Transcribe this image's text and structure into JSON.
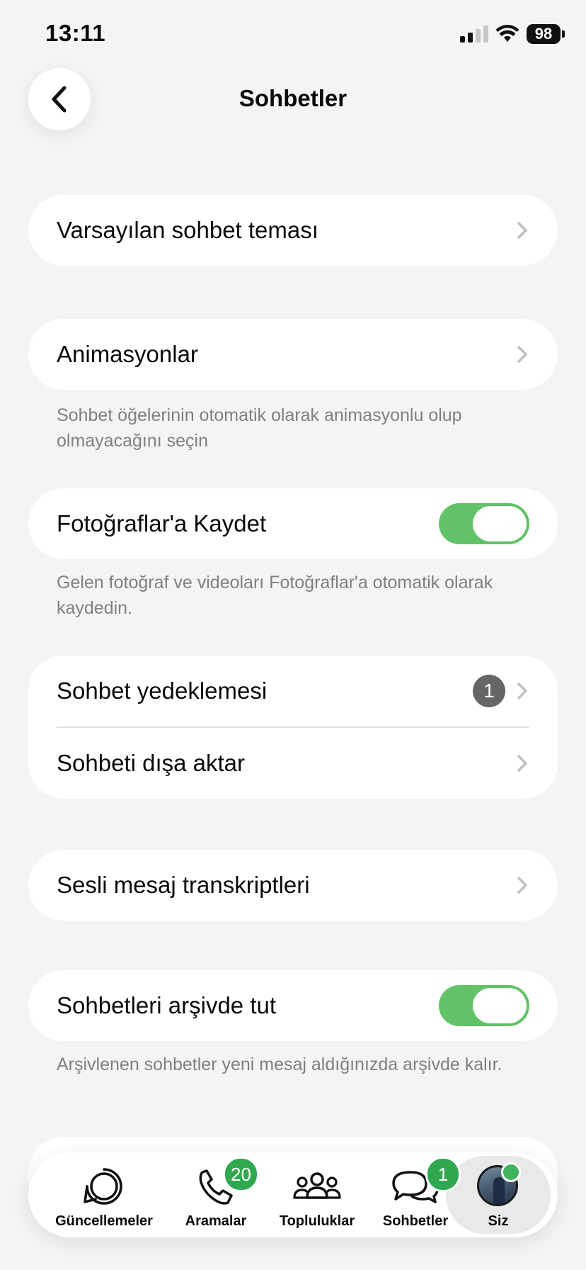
{
  "status_bar": {
    "time": "13:11",
    "battery": "98"
  },
  "header": {
    "title": "Sohbetler"
  },
  "settings": {
    "default_theme": {
      "label": "Varsayılan sohbet teması"
    },
    "animations": {
      "label": "Animasyonlar",
      "note": "Sohbet öğelerinin otomatik olarak animasyonlu olup olmayacağını seçin"
    },
    "save_to_photos": {
      "label": "Fotoğraflar'a Kaydet",
      "enabled": true,
      "note": "Gelen fotoğraf ve videoları Fotoğraflar'a otomatik olarak kaydedin."
    },
    "chat_backup": {
      "label": "Sohbet yedeklemesi",
      "badge": "1"
    },
    "export_chat": {
      "label": "Sohbeti dışa aktar"
    },
    "voice_transcripts": {
      "label": "Sesli mesaj transkriptleri"
    },
    "keep_archived": {
      "label": "Sohbetleri arşivde tut",
      "enabled": true,
      "note": "Arşivlenen sohbetler yeni mesaj aldığınızda arşivde kalır."
    }
  },
  "tabbar": {
    "active": "Siz",
    "accent": "#2fa84f",
    "tabs": [
      {
        "label": "Güncellemeler",
        "icon": "updates-icon"
      },
      {
        "label": "Aramalar",
        "icon": "phone-icon",
        "badge": "20"
      },
      {
        "label": "Topluluklar",
        "icon": "communities-icon"
      },
      {
        "label": "Sohbetler",
        "icon": "chats-icon",
        "badge": "1"
      },
      {
        "label": "Siz",
        "icon": "avatar"
      }
    ]
  },
  "colors": {
    "toggle_on": "#62c267",
    "background": "#f4f4f4",
    "badge_gray": "#666666"
  }
}
